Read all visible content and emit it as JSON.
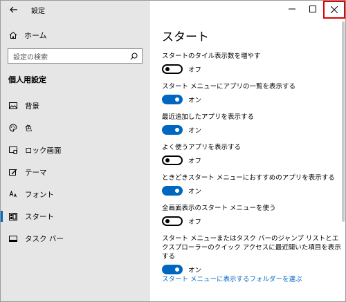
{
  "app": {
    "title": "設定"
  },
  "sidebar": {
    "home_label": "ホーム",
    "search_placeholder": "設定の検索",
    "section_title": "個人用設定",
    "items": [
      {
        "label": "背景",
        "icon": "image-icon"
      },
      {
        "label": "色",
        "icon": "palette-icon"
      },
      {
        "label": "ロック画面",
        "icon": "lock-screen-icon"
      },
      {
        "label": "テーマ",
        "icon": "theme-icon"
      },
      {
        "label": "フォント",
        "icon": "font-icon"
      },
      {
        "label": "スタート",
        "icon": "start-icon",
        "selected": true
      },
      {
        "label": "タスク バー",
        "icon": "taskbar-icon"
      }
    ]
  },
  "main": {
    "title": "スタート",
    "settings": [
      {
        "label": "スタートのタイル表示数を増やす",
        "state": "オフ",
        "on": false
      },
      {
        "label": "スタート メニューにアプリの一覧を表示する",
        "state": "オン",
        "on": true
      },
      {
        "label": "最近追加したアプリを表示する",
        "state": "オン",
        "on": true
      },
      {
        "label": "よく使うアプリを表示する",
        "state": "オフ",
        "on": false
      },
      {
        "label": "ときどきスタート メニューにおすすめのアプリを表示する",
        "state": "オン",
        "on": true
      },
      {
        "label": "全画面表示のスタート メニューを使う",
        "state": "オフ",
        "on": false
      },
      {
        "label": "スタート メニューまたはタスク バーのジャンプ リストとエクスプローラーのクイック アクセスに最近開いた項目を表示する",
        "state": "オン",
        "on": true
      }
    ],
    "link": "スタート メニューに表示するフォルダーを選ぶ"
  },
  "colors": {
    "accent": "#0067c0",
    "sidebar_bg": "#e6e6e6",
    "highlight_border": "#e00000"
  }
}
